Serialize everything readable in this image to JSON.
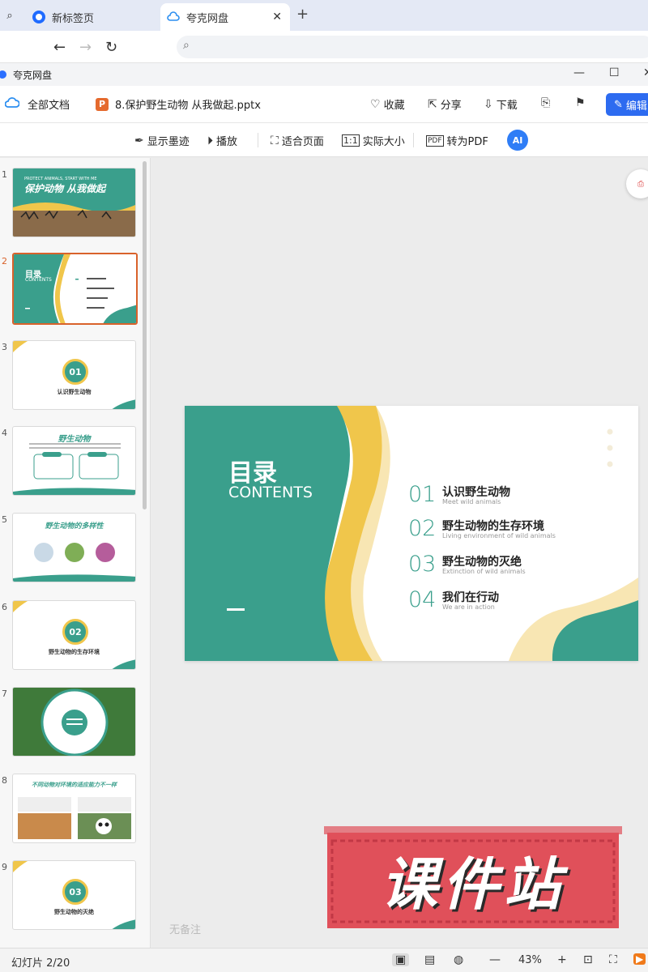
{
  "browser": {
    "tabs": [
      {
        "label": "新标签页"
      },
      {
        "label": "夸克网盘"
      }
    ]
  },
  "app": {
    "title": "夸克网盘",
    "all_docs": "全部文档",
    "file_name": "8.保护野生动物 从我做起.pptx",
    "file_badge": "P",
    "actions": {
      "collect": "收藏",
      "share": "分享",
      "download": "下载",
      "edit": "编辑"
    }
  },
  "toolbar": {
    "show_ink": "显示墨迹",
    "play": "播放",
    "fit_page": "适合页面",
    "actual_size": "实际大小",
    "to_pdf": "转为PDF",
    "ai": "AI"
  },
  "thumbnails": [
    {
      "num": "1",
      "title": "保护动物 从我做起",
      "subtitle": "PROTECT ANIMALS, START WITH ME"
    },
    {
      "num": "2",
      "title": "目录",
      "subtitle": "CONTENTS"
    },
    {
      "num": "3",
      "badge": "01",
      "caption": "认识野生动物"
    },
    {
      "num": "4",
      "title": "野生动物"
    },
    {
      "num": "5",
      "title": "野生动物的多样性"
    },
    {
      "num": "6",
      "badge": "02",
      "caption": "野生动物的生存环境"
    },
    {
      "num": "7"
    },
    {
      "num": "8",
      "title": "不同动物对环境的适应能力不一样"
    },
    {
      "num": "9",
      "badge": "03",
      "caption": "野生动物的灭绝"
    }
  ],
  "slide": {
    "title": "目录",
    "subtitle": "CONTENTS",
    "items": [
      {
        "num": "01",
        "heading": "认识野生动物",
        "english": "Meet wild animals"
      },
      {
        "num": "02",
        "heading": "野生动物的生存环境",
        "english": "Living environment of wild animals"
      },
      {
        "num": "03",
        "heading": "野生动物的灭绝",
        "english": "Extinction of wild animals"
      },
      {
        "num": "04",
        "heading": "我们在行动",
        "english": "We are in action"
      }
    ],
    "colors": {
      "teal": "#3a9f8c",
      "yellow": "#f0c64b",
      "cream": "#f8e6b3"
    }
  },
  "notes": "无备注",
  "watermark": "课件站",
  "status": {
    "page": "幻灯片 2/20",
    "zoom": "43%"
  }
}
